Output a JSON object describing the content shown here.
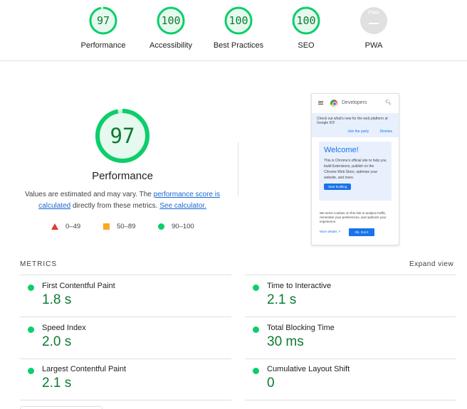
{
  "categories": [
    {
      "id": "performance",
      "label": "Performance",
      "score": "97"
    },
    {
      "id": "accessibility",
      "label": "Accessibility",
      "score": "100"
    },
    {
      "id": "best-practices",
      "label": "Best Practices",
      "score": "100"
    },
    {
      "id": "seo",
      "label": "SEO",
      "score": "100"
    },
    {
      "id": "pwa",
      "label": "PWA",
      "score": "PWA"
    }
  ],
  "performance": {
    "score": "97",
    "title": "Performance",
    "desc_part1": "Values are estimated and may vary. The ",
    "link_score": "performance score is calculated",
    "desc_part2": " directly from these metrics. ",
    "link_calc": "See calculator.",
    "legend": {
      "fail": "0–49",
      "average": "50–89",
      "pass": "90–100"
    }
  },
  "screenshot": {
    "brand": "Developers",
    "banner_text": "Check out what's new for the web platform at Google I/O!",
    "banner_link1": "Join the party",
    "banner_link2": "Dismiss",
    "welcome": "Welcome!",
    "card_text": "This is Chrome's official site to help you build Extensions, publish on the Chrome Web Store, optimize your website, and more.",
    "start_button": "Start building",
    "cookie_text": "We serve cookies on this site to analyze traffic, remember your preferences, and optimize your experience.",
    "more_details": "More details",
    "ok_button": "Ok, Got it"
  },
  "metrics": {
    "heading": "METRICS",
    "expand_label": "Expand view",
    "items": [
      {
        "name": "First Contentful Paint",
        "value": "1.8 s"
      },
      {
        "name": "Time to Interactive",
        "value": "2.1 s"
      },
      {
        "name": "Speed Index",
        "value": "2.0 s"
      },
      {
        "name": "Total Blocking Time",
        "value": "30 ms"
      },
      {
        "name": "Largest Contentful Paint",
        "value": "2.1 s"
      },
      {
        "name": "Cumulative Layout Shift",
        "value": "0"
      }
    ]
  },
  "colors": {
    "pass": "#0cce6b",
    "pass_text": "#0c7a33",
    "average": "#f9a825",
    "fail": "#e53935",
    "link": "#1967d2",
    "na": "#e0e0e0"
  },
  "gauge_fill_fraction": {
    "performance": 0.97,
    "accessibility": 1.0,
    "best-practices": 1.0,
    "seo": 1.0
  }
}
